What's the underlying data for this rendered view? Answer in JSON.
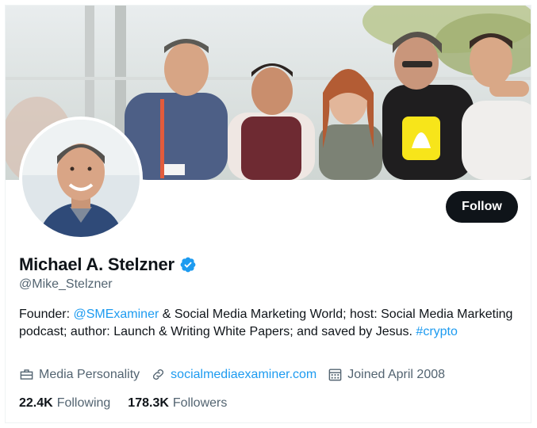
{
  "profile": {
    "display_name": "Michael A. Stelzner",
    "handle": "@Mike_Stelzner",
    "verified": true,
    "follow_label": "Follow",
    "bio": {
      "prefix": "Founder: ",
      "mention": "@SMExaminer",
      "middle": " & Social Media Marketing World; host: Social Media Marketing podcast; author: Launch & Writing White Papers; and saved by Jesus. ",
      "hashtag": "#crypto"
    },
    "meta": {
      "category": "Media Personality",
      "website": "socialmediaexaminer.com",
      "joined": "Joined April 2008"
    },
    "stats": {
      "following_count": "22.4K",
      "following_label": "Following",
      "followers_count": "178.3K",
      "followers_label": "Followers"
    }
  },
  "icons": {
    "verified": "verified-badge-icon",
    "category": "briefcase-icon",
    "website": "link-icon",
    "joined": "calendar-icon"
  },
  "colors": {
    "accent": "#1d9bf0",
    "text_primary": "#0f1419",
    "text_secondary": "#536471",
    "button_bg": "#0f1419"
  }
}
